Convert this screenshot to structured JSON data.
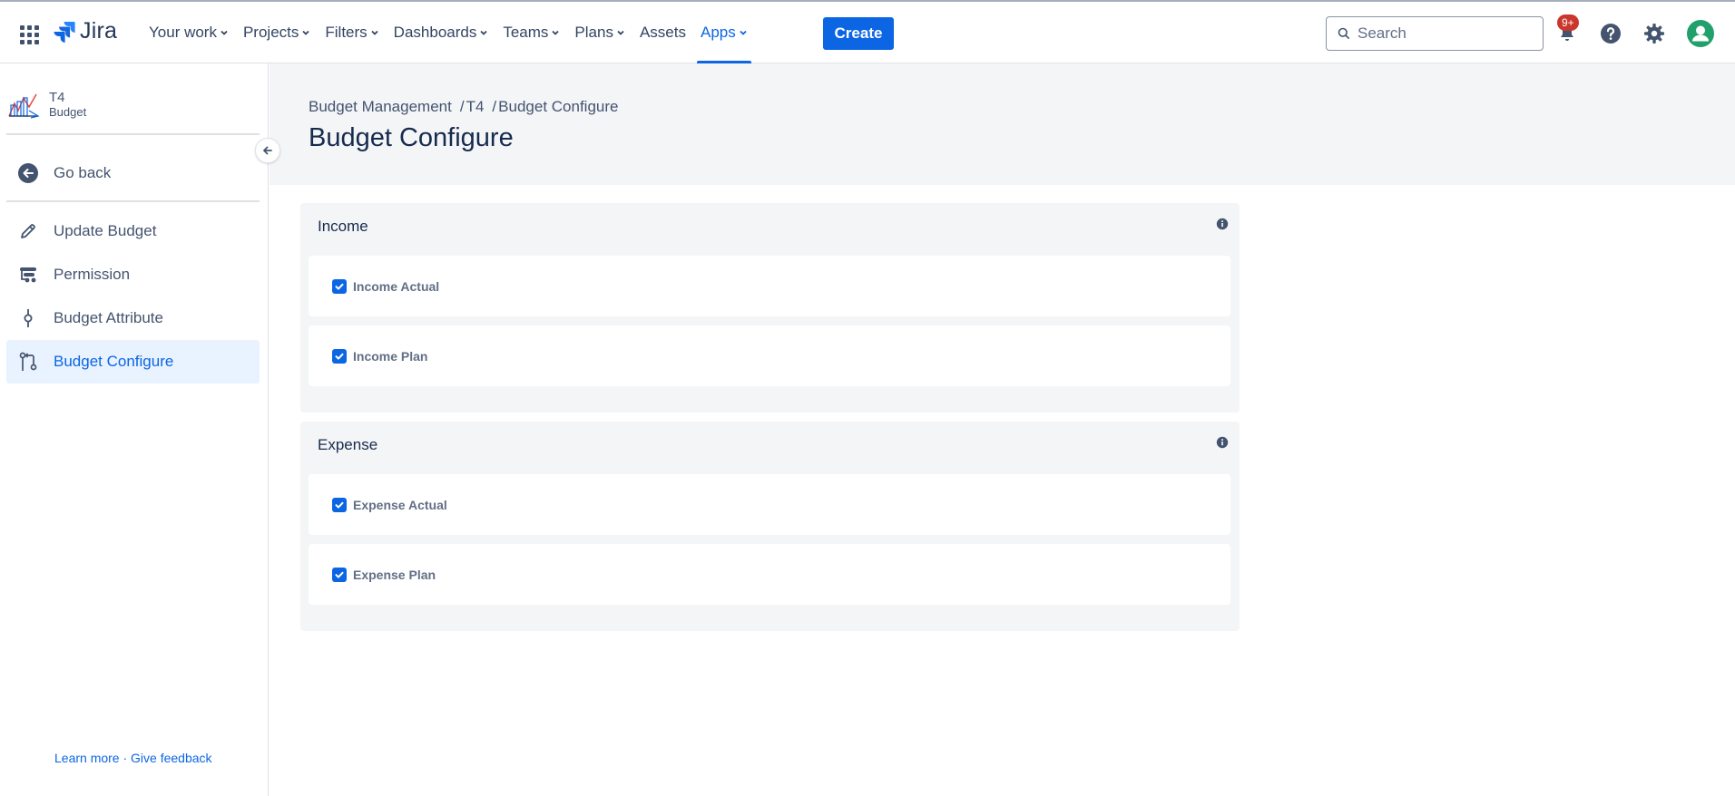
{
  "topnav": {
    "logo_text": "Jira",
    "items": [
      {
        "label": "Your work"
      },
      {
        "label": "Projects"
      },
      {
        "label": "Filters"
      },
      {
        "label": "Dashboards"
      },
      {
        "label": "Teams"
      },
      {
        "label": "Plans"
      },
      {
        "label": "Assets"
      },
      {
        "label": "Apps"
      }
    ],
    "active_item": "Apps",
    "create_label": "Create",
    "search_placeholder": "Search",
    "notifications_badge": "9+",
    "accent_color": "#0c66e4",
    "avatar_color": "#22a06b"
  },
  "sidebar": {
    "project_name": "T4",
    "project_type": "Budget",
    "go_back_label": "Go back",
    "items": [
      {
        "label": "Update Budget",
        "icon": "pencil-icon"
      },
      {
        "label": "Permission",
        "icon": "permission-icon"
      },
      {
        "label": "Budget Attribute",
        "icon": "commit-icon"
      },
      {
        "label": "Budget Configure",
        "icon": "branch-icon",
        "selected": true
      }
    ],
    "learn_more": "Learn more",
    "separator": "·",
    "give_feedback": "Give feedback"
  },
  "main": {
    "breadcrumb": [
      "Budget Management",
      "T4",
      "Budget Configure"
    ],
    "breadcrumb_separator": "/",
    "title": "Budget Configure",
    "sections": [
      {
        "title": "Income",
        "rows": [
          {
            "label": "Income Actual",
            "checked": true
          },
          {
            "label": "Income Plan",
            "checked": true
          }
        ]
      },
      {
        "title": "Expense",
        "rows": [
          {
            "label": "Expense Actual",
            "checked": true
          },
          {
            "label": "Expense Plan",
            "checked": true
          }
        ]
      }
    ]
  }
}
